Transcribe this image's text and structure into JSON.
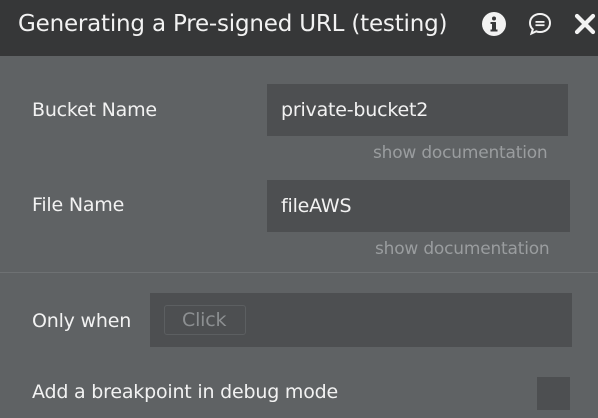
{
  "header": {
    "title": "Generating a Pre-signed URL (testing)",
    "icons": [
      "info-icon",
      "comment-icon",
      "close-icon"
    ]
  },
  "fields": {
    "bucket_name": {
      "label": "Bucket Name",
      "value": "private-bucket2",
      "doc_link": "show documentation"
    },
    "file_name": {
      "label": "File Name",
      "value": "fileAWS",
      "doc_link": "show documentation"
    }
  },
  "condition": {
    "label": "Only when",
    "placeholder": "Click"
  },
  "breakpoint": {
    "label": "Add a breakpoint in debug mode",
    "checked": false
  },
  "colors": {
    "header_bg": "#363738",
    "panel_bg": "#5f6264",
    "field_bg": "#4d4f51",
    "text": "#f2f2f2",
    "muted_text": "#9a9d9f"
  }
}
